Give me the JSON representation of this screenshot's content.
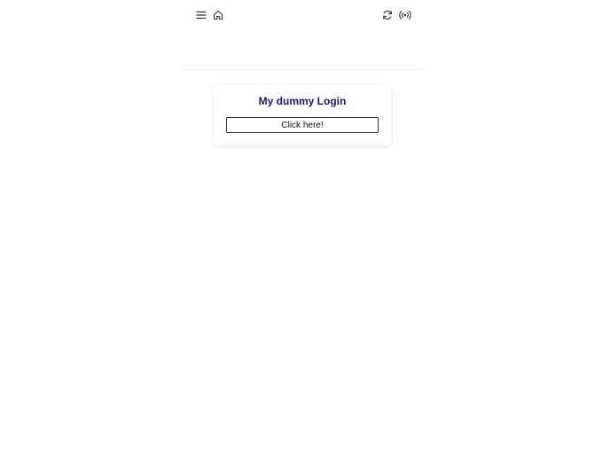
{
  "toolbar": {
    "left_icons": [
      "menu-icon",
      "home-icon"
    ],
    "right_icons": [
      "refresh-icon",
      "broadcast-icon"
    ]
  },
  "card": {
    "title": "My dummy Login",
    "button_label": "Click here!"
  },
  "colors": {
    "title": "#1a1577",
    "icon": "#333333",
    "button_border": "#333333"
  }
}
